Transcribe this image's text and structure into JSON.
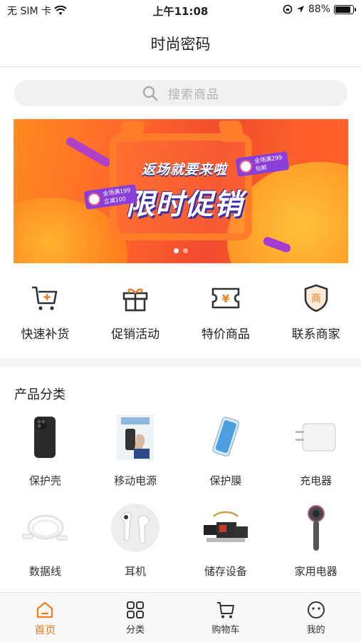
{
  "status_bar": {
    "carrier": "无 SIM 卡",
    "time": "上午11:08",
    "battery": "88%",
    "battery_level": 0.88
  },
  "navbar": {
    "title": "时尚密码"
  },
  "search": {
    "placeholder": "搜索商品",
    "icon": "search-icon"
  },
  "banner": {
    "slogan": "返场就要来啦",
    "headline": "限时促销",
    "tag_left": [
      "全场满199",
      "立减100"
    ],
    "tag_right": [
      "全场满299",
      "包邮"
    ],
    "page_count": 2,
    "active_page": 1
  },
  "quick_actions": [
    {
      "label": "快速补货",
      "icon": "cart-plus-icon"
    },
    {
      "label": "促销活动",
      "icon": "gift-icon"
    },
    {
      "label": "特价商品",
      "icon": "yen-ticket-icon"
    },
    {
      "label": "联系商家",
      "icon": "shop-shield-icon"
    }
  ],
  "shop_badge_char": "商",
  "ticket_char": "¥",
  "categories": {
    "title": "产品分类",
    "items": [
      {
        "label": "保护壳"
      },
      {
        "label": "移动电源"
      },
      {
        "label": "保护膜"
      },
      {
        "label": "充电器"
      },
      {
        "label": "数据线"
      },
      {
        "label": "耳机"
      },
      {
        "label": "储存设备"
      },
      {
        "label": "家用电器"
      }
    ]
  },
  "tabbar": {
    "items": [
      {
        "label": "首页",
        "icon": "home-icon",
        "active": true
      },
      {
        "label": "分类",
        "icon": "grid-icon",
        "active": false
      },
      {
        "label": "购物车",
        "icon": "cart-icon",
        "active": false
      },
      {
        "label": "我的",
        "icon": "smiley-icon",
        "active": false
      }
    ]
  },
  "colors": {
    "accent": "#f07c1e",
    "icon_dark": "#333333",
    "badge_fill": "#fde9d9"
  }
}
